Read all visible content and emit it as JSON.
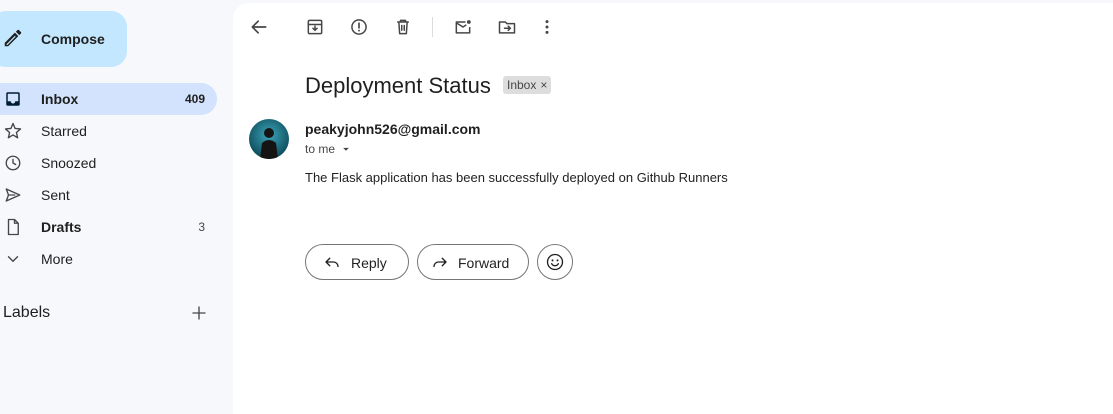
{
  "sidebar": {
    "compose_label": "Compose",
    "items": [
      {
        "label": "Inbox",
        "count": "409",
        "icon": "inbox-icon"
      },
      {
        "label": "Starred",
        "count": "",
        "icon": "star-icon"
      },
      {
        "label": "Snoozed",
        "count": "",
        "icon": "clock-icon"
      },
      {
        "label": "Sent",
        "count": "",
        "icon": "send-icon"
      },
      {
        "label": "Drafts",
        "count": "3",
        "icon": "draft-icon"
      },
      {
        "label": "More",
        "count": "",
        "icon": "chevron-down-icon"
      }
    ],
    "labels_heading": "Labels"
  },
  "toolbar": {
    "icons": [
      "back-arrow-icon",
      "archive-icon",
      "report-spam-icon",
      "delete-icon",
      "mark-unread-icon",
      "move-to-icon",
      "more-vert-icon"
    ]
  },
  "message": {
    "subject": "Deployment Status",
    "label_chip": "Inbox",
    "chip_close": "×",
    "sender": "peakyjohn526@gmail.com",
    "recipient": "to me",
    "body": "The Flask application has been successfully deployed on Github Runners"
  },
  "actions": {
    "reply_label": "Reply",
    "forward_label": "Forward"
  },
  "colors": {
    "background": "#f6f8fc",
    "compose_bg": "#c2e7ff",
    "active_nav": "#d3e3fd",
    "chip_bg": "#dddddd"
  }
}
